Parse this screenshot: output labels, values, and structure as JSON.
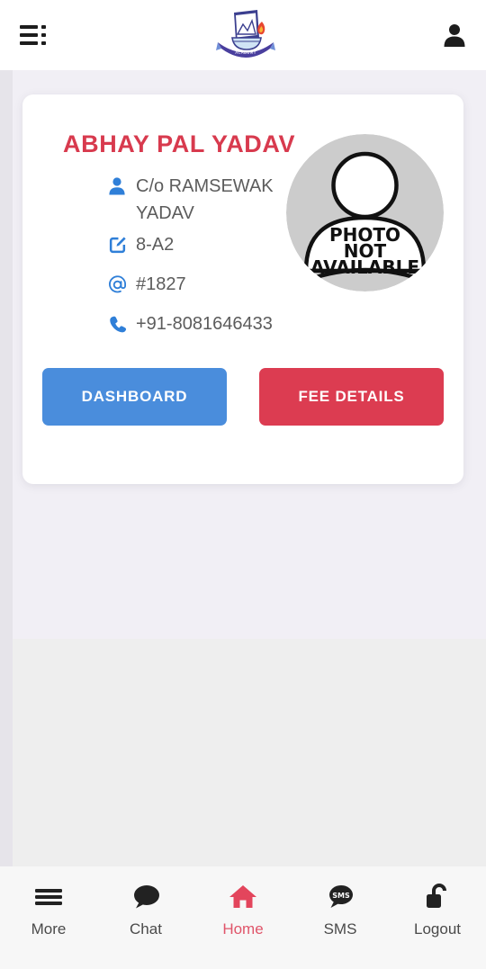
{
  "appbar": {
    "menu_icon": "menu-dots-icon",
    "logo_icon": "school-crest-logo",
    "account_icon": "account-person-icon"
  },
  "profile": {
    "name": "ABHAY PAL YADAV",
    "details": [
      {
        "icon": "person-icon",
        "text": "C/o RAMSEWAK YADAV"
      },
      {
        "icon": "edit-square-icon",
        "text": "8-A2"
      },
      {
        "icon": "at-sign-icon",
        "text": "#1827"
      },
      {
        "icon": "phone-icon",
        "text": "+91-8081646433"
      }
    ],
    "avatar": {
      "icon": "photo-not-available-avatar",
      "line1": "PHOTO",
      "line2": "NOT",
      "line3": "AVAILABLE"
    },
    "buttons": {
      "dashboard": "DASHBOARD",
      "fee_details": "FEE DETAILS"
    }
  },
  "bottom_nav": {
    "items": [
      {
        "label": "More",
        "icon": "hamburger-icon",
        "active": false
      },
      {
        "label": "Chat",
        "icon": "chat-bubble-icon",
        "active": false
      },
      {
        "label": "Home",
        "icon": "home-icon",
        "active": true
      },
      {
        "label": "SMS",
        "icon": "sms-bubble-icon",
        "active": false
      },
      {
        "label": "Logout",
        "icon": "unlock-padlock-icon",
        "active": false
      }
    ]
  },
  "colors": {
    "accent_red": "#d83a4e",
    "accent_blue": "#4a8ddc",
    "nav_active": "#e0556a",
    "icon_blue": "#2f7fd8",
    "page_bg": "#f1eff5"
  }
}
